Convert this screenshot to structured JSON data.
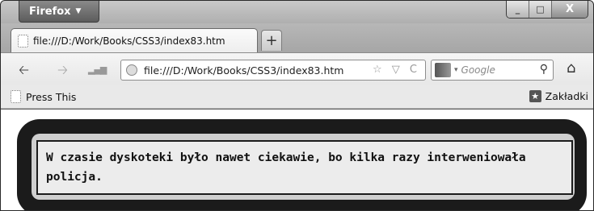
{
  "app": {
    "menu_label": "Firefox",
    "menu_caret": "▼"
  },
  "window_controls": {
    "minimize": "_",
    "maximize": "□",
    "close": "X"
  },
  "tab": {
    "title": "file:///D:/Work/Books/CSS3/index83.htm",
    "new_tab_label": "+"
  },
  "nav": {
    "back": "◆",
    "forward": "➔",
    "url": "file:///D:/Work/Books/CSS3/index83.htm",
    "url_tools": "☆ ▽ C",
    "search_placeholder": "Google",
    "search_caret": "▾",
    "search_button": "⚲",
    "home": "⌂"
  },
  "bookmarks": {
    "left_item": "Press This",
    "right_item": "Zakładki",
    "right_icon_glyph": "★"
  },
  "content": {
    "paragraph": "W czasie dyskoteki było nawet ciekawie, bo kilka razy interweniowała policja."
  }
}
